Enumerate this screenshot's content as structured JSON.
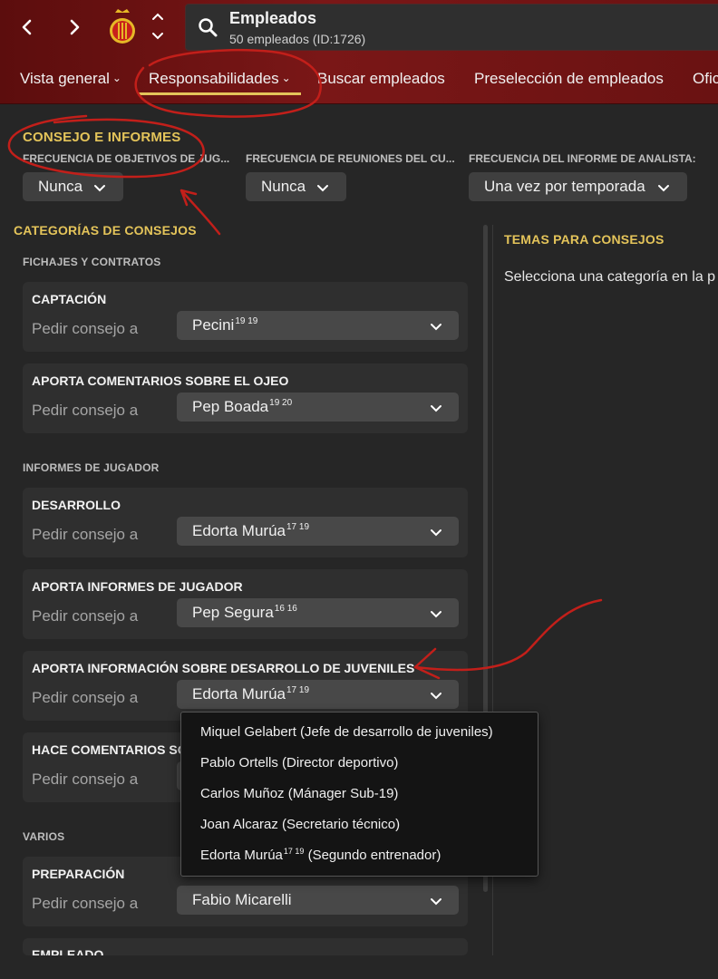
{
  "header": {
    "title": "Empleados",
    "subtitle": "50 empleados (ID:1726)",
    "icons": {
      "back": "chevron-left-icon",
      "forward": "chevron-right-icon",
      "search": "search-icon",
      "club": "club-crest-icon"
    }
  },
  "tabs": [
    {
      "label": "Vista general",
      "has_dropdown": true
    },
    {
      "label": "Responsabilidades",
      "has_dropdown": true,
      "active": true
    },
    {
      "label": "Buscar empleados"
    },
    {
      "label": "Preselección de empleados"
    },
    {
      "label": "Ofic"
    }
  ],
  "consejo": {
    "title": "CONSEJO E INFORMES",
    "freqs": [
      {
        "label": "FRECUENCIA DE OBJETIVOS DE JUG...",
        "value": "Nunca"
      },
      {
        "label": "FRECUENCIA DE REUNIONES DEL CU...",
        "value": "Nunca"
      },
      {
        "label": "FRECUENCIA DEL INFORME DE ANALISTA:",
        "value": "Una vez por temporada"
      }
    ]
  },
  "categorias": {
    "title": "CATEGORÍAS DE CONSEJOS",
    "ask_label": "Pedir consejo a",
    "groups": [
      {
        "name": "FICHAJES Y CONTRATOS"
      },
      {
        "name": "INFORMES DE JUGADOR"
      },
      {
        "name": "VARIOS"
      }
    ],
    "cards": [
      {
        "title": "CAPTACIÓN",
        "value": "Pecini",
        "sup": "19 19"
      },
      {
        "title": "APORTA COMENTARIOS SOBRE EL OJEO",
        "value": "Pep Boada",
        "sup": "19 20"
      },
      {
        "title": "DESARROLLO",
        "value": "Edorta Murúa",
        "sup": "17 19"
      },
      {
        "title": "APORTA INFORMES DE JUGADOR",
        "value": "Pep Segura",
        "sup": "16 16"
      },
      {
        "title": "APORTA INFORMACIÓN SOBRE DESARROLLO DE JUVENILES",
        "value": "Edorta Murúa",
        "sup": "17 19"
      },
      {
        "title": "HACE COMENTARIOS SO",
        "value": "",
        "sup": ""
      },
      {
        "title": "PREPARACIÓN",
        "value": "Fabio Micarelli",
        "sup": ""
      },
      {
        "title": "EMPLEADO",
        "value": "",
        "sup": ""
      }
    ]
  },
  "temas": {
    "title": "TEMAS PARA CONSEJOS",
    "text": "Selecciona una categoría en la p"
  },
  "dropdown": {
    "items": [
      {
        "text": "Miquel Gelabert (Jefe de desarrollo de juveniles)"
      },
      {
        "text": "Pablo Ortells (Director deportivo)"
      },
      {
        "text": "Carlos Muñoz (Mánager Sub-19)"
      },
      {
        "text": "Joan Alcaraz (Secretario técnico)"
      },
      {
        "pre": "Edorta Murúa",
        "sup": "17 19",
        "post": " (Segundo entrenador)"
      }
    ]
  },
  "colors": {
    "accent": "#e4c45a",
    "header_red": "#7a1717",
    "annotation_red": "#c21f1a",
    "background": "#262626"
  }
}
